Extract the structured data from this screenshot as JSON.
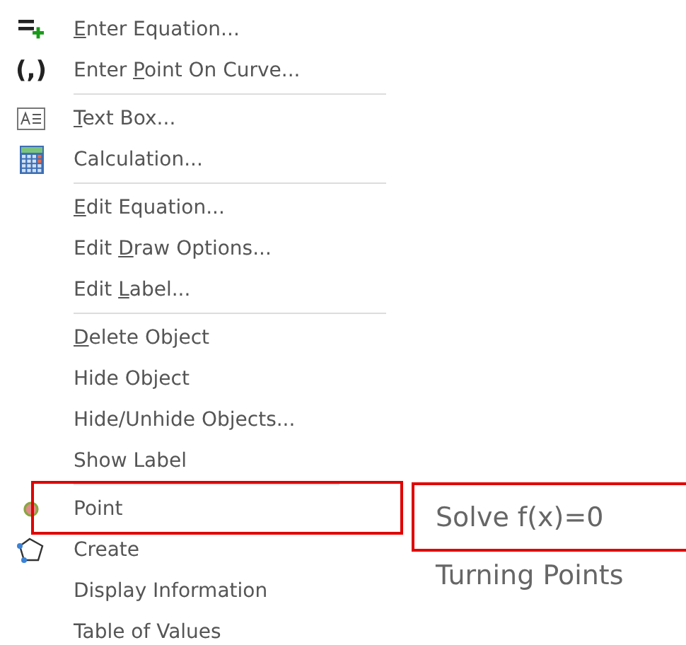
{
  "menu": [
    {
      "kind": "equation",
      "key": "E",
      "post": "nter Equation...",
      "highlighted": false
    },
    {
      "kind": "glyph",
      "glyph": "(,)",
      "pre": "Enter ",
      "key": "P",
      "post": "oint On Curve...",
      "highlighted": false
    },
    {
      "kind": "separator",
      "short": false
    },
    {
      "kind": "textbox",
      "key": "T",
      "post": "ext Box...",
      "highlighted": false
    },
    {
      "kind": "calculator",
      "pre": "Calculation...",
      "highlighted": false
    },
    {
      "kind": "separator",
      "short": false
    },
    {
      "kind": "plain",
      "key": "E",
      "post": "dit Equation...",
      "highlighted": false
    },
    {
      "kind": "plain",
      "pre": "Edit ",
      "key": "D",
      "post": "raw Options...",
      "highlighted": false
    },
    {
      "kind": "plain",
      "pre": "Edit ",
      "key": "L",
      "post": "abel...",
      "highlighted": false
    },
    {
      "kind": "separator",
      "short": false
    },
    {
      "kind": "plain",
      "key": "D",
      "post": "elete Object",
      "highlighted": false
    },
    {
      "kind": "plain",
      "pre": "Hide Object",
      "highlighted": false
    },
    {
      "kind": "plain",
      "pre": "Hide/Unhide Objects...",
      "highlighted": false
    },
    {
      "kind": "plain",
      "pre": "Show Label",
      "highlighted": false
    },
    {
      "kind": "separator",
      "short": true
    },
    {
      "kind": "point",
      "pre": "Point",
      "highlighted": true
    },
    {
      "kind": "polygon",
      "pre": "Create",
      "highlighted": false
    },
    {
      "kind": "plain",
      "pre": "Display Information",
      "highlighted": false
    },
    {
      "kind": "plain",
      "pre": "Table of Values",
      "highlighted": false
    }
  ],
  "submenu": [
    {
      "label": "Solve f(x)=0",
      "highlighted": true
    },
    {
      "label": "Turning Points",
      "highlighted": false
    }
  ]
}
